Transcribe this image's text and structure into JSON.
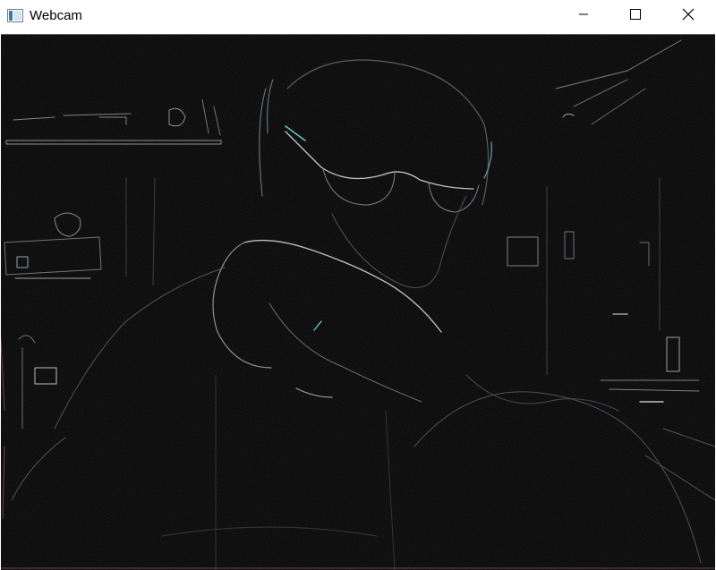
{
  "window": {
    "title": "Webcam",
    "controls": {
      "minimize_icon": "minimize-icon",
      "maximize_icon": "maximize-icon",
      "close_icon": "close-icon"
    }
  },
  "feed": {
    "description_colors": {
      "background": "#050505",
      "edge_light": "#9aa0a6",
      "edge_cyan": "#5ec8c8",
      "edge_pink": "#c87890"
    }
  }
}
